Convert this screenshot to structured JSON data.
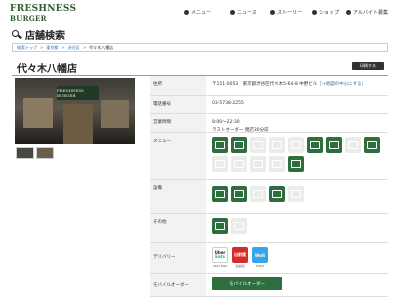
{
  "header": {
    "logo_line1": "FRESHNESS",
    "logo_line2": "BURGER",
    "nav": [
      {
        "label": "メニュー",
        "icon": "menu-icon"
      },
      {
        "label": "ニュース",
        "icon": "news-icon"
      },
      {
        "label": "ストーリー",
        "icon": "story-icon"
      },
      {
        "label": "ショップ",
        "icon": "shop-icon"
      },
      {
        "label": "アルバイト募集",
        "icon": "person-icon"
      }
    ]
  },
  "page_title": "店舗検索",
  "breadcrumb": [
    "検索トップ",
    "東京都",
    "渋谷区",
    "代々木八幡店"
  ],
  "store": {
    "name": "代々木八幡店",
    "print_label": "印刷する",
    "photo_sign": "FRESHNESS BURGER"
  },
  "info": {
    "address": {
      "label": "住所",
      "value": "〒151-0053　東京都渋谷区代々木5-64-8 中野ビル",
      "route": "［→地図の中心にする］"
    },
    "phone": {
      "label": "電話番号",
      "value": "03-5738-2255"
    },
    "hours": {
      "label": "営業時間",
      "line1": "8:00～22:30",
      "line2": "ラストオーダー 閉店30分前"
    },
    "menu": {
      "label": "メニュー"
    },
    "facilities": {
      "label": "設備"
    },
    "other": {
      "label": "その他"
    },
    "delivery": {
      "label": "デリバリー",
      "services": [
        {
          "name": "Uber Eats",
          "caption": "Uber Eats"
        },
        {
          "name": "出前館",
          "caption": "出前館"
        },
        {
          "name": "Wolt",
          "caption": "WOLT"
        }
      ]
    },
    "mobile_order": {
      "label": "モバイルオーダー",
      "button": "モバイルオーダー"
    }
  },
  "colors": {
    "brand_green": "#2e6e3e",
    "link_blue": "#2a6fb0"
  }
}
